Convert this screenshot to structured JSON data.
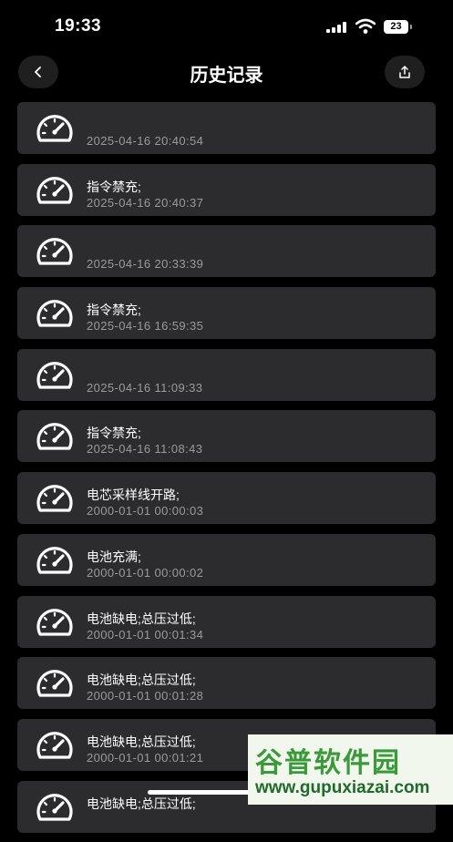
{
  "status_bar": {
    "time": "19:33",
    "battery": "23"
  },
  "nav": {
    "title": "历史记录",
    "back_icon": "chevron-left-icon",
    "share_icon": "share-icon"
  },
  "records": [
    {
      "message": "",
      "time": "2025-04-16 20:40:54"
    },
    {
      "message": "指令禁充;",
      "time": "2025-04-16 20:40:37"
    },
    {
      "message": "",
      "time": "2025-04-16 20:33:39"
    },
    {
      "message": "指令禁充;",
      "time": "2025-04-16 16:59:35"
    },
    {
      "message": "",
      "time": "2025-04-16 11:09:33"
    },
    {
      "message": "指令禁充;",
      "time": "2025-04-16 11:08:43"
    },
    {
      "message": "电芯采样线开路;",
      "time": "2000-01-01 00:00:03"
    },
    {
      "message": "电池充满;",
      "time": "2000-01-01 00:00:02"
    },
    {
      "message": "电池缺电;总压过低;",
      "time": "2000-01-01 00:01:34"
    },
    {
      "message": "电池缺电;总压过低;",
      "time": "2000-01-01 00:01:28"
    },
    {
      "message": "电池缺电;总压过低;",
      "time": "2000-01-01 00:01:21"
    },
    {
      "message": "电池缺电;总压过低;",
      "time": ""
    }
  ],
  "watermark": {
    "title": "谷普软件园",
    "url": "www.gupuxiazai.com"
  },
  "colors": {
    "background": "#000000",
    "card": "#2c2c2e",
    "time_text": "#9b9b9b",
    "watermark_green": "#3a9a3a"
  }
}
